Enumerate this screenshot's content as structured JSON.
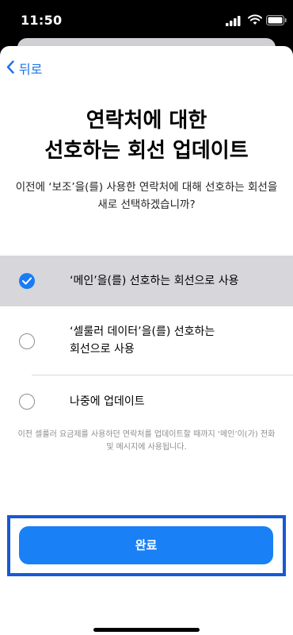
{
  "status_bar": {
    "time": "11:50"
  },
  "nav": {
    "back_label": "뒤로"
  },
  "title": {
    "line1": "연락처에 대한",
    "line2": "선호하는 회선 업데이트"
  },
  "subtitle": "이전에 ‘보조’을(를) 사용한 연락처에 대해 선호하는 회선을 새로 선택하겠습니까?",
  "options": [
    {
      "label": "‘메인’을(를) 선호하는 회선으로 사용",
      "selected": true
    },
    {
      "line1": "‘셀룰러 데이터’을(를) 선호하는",
      "line2": "회선으로 사용",
      "selected": false
    },
    {
      "label": "나중에 업데이트",
      "selected": false
    }
  ],
  "footnote": "이전 셀룰러 요금제를 사용하던 연락처를 업데이트할 때까지 ‘메인’이(가) 전화 및 메시지에 사용됩니다.",
  "done_label": "완료",
  "colors": {
    "accent": "#1a80f6",
    "selected_row": "#d6d6db"
  }
}
